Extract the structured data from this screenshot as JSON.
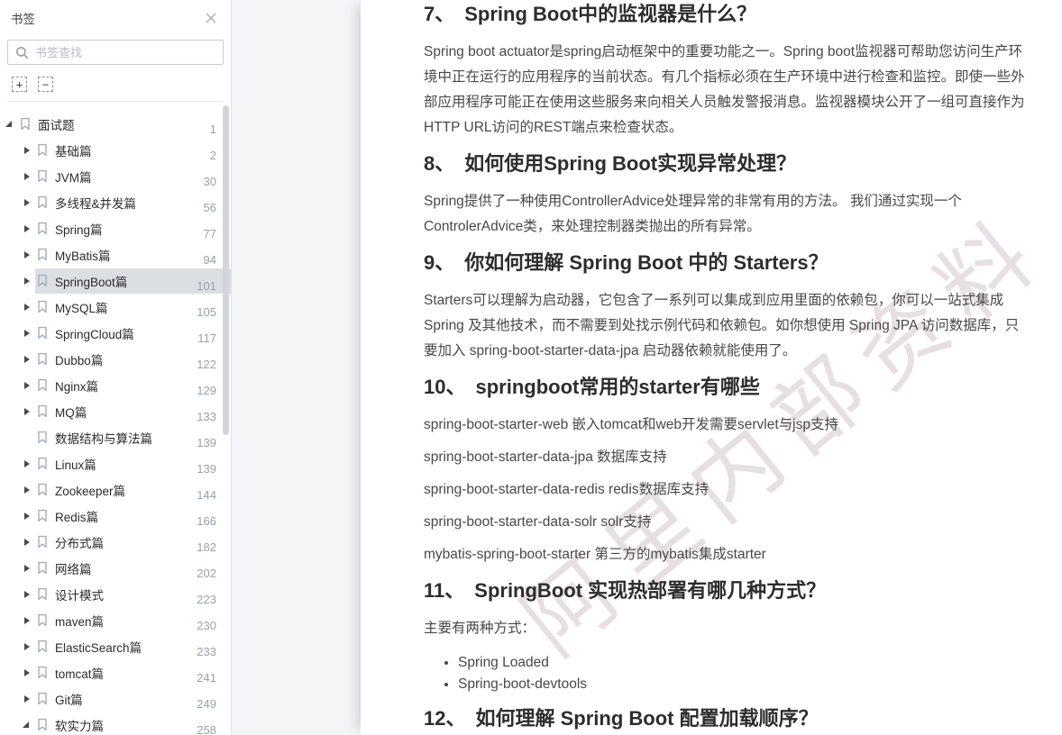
{
  "sidebar": {
    "title": "书签",
    "search": {
      "placeholder": "书签查找"
    },
    "toolbar": {
      "expand_all": "+",
      "collapse_all": "−"
    },
    "tree": [
      {
        "label": "面试题",
        "page": "1",
        "level": 0,
        "state": "expanded",
        "selected": false
      },
      {
        "label": "基础篇",
        "page": "2",
        "level": 1,
        "state": "collapsed",
        "selected": false
      },
      {
        "label": "JVM篇",
        "page": "30",
        "level": 1,
        "state": "collapsed",
        "selected": false
      },
      {
        "label": "多线程&并发篇",
        "page": "56",
        "level": 1,
        "state": "collapsed",
        "selected": false
      },
      {
        "label": "Spring篇",
        "page": "77",
        "level": 1,
        "state": "collapsed",
        "selected": false
      },
      {
        "label": "MyBatis篇",
        "page": "94",
        "level": 1,
        "state": "collapsed",
        "selected": false
      },
      {
        "label": "SpringBoot篇",
        "page": "101",
        "level": 1,
        "state": "collapsed",
        "selected": true
      },
      {
        "label": "MySQL篇",
        "page": "105",
        "level": 1,
        "state": "collapsed",
        "selected": false
      },
      {
        "label": "SpringCloud篇",
        "page": "117",
        "level": 1,
        "state": "collapsed",
        "selected": false
      },
      {
        "label": "Dubbo篇",
        "page": "122",
        "level": 1,
        "state": "collapsed",
        "selected": false
      },
      {
        "label": "Nginx篇",
        "page": "129",
        "level": 1,
        "state": "collapsed",
        "selected": false
      },
      {
        "label": "MQ篇",
        "page": "133",
        "level": 1,
        "state": "collapsed",
        "selected": false
      },
      {
        "label": "数据结构与算法篇",
        "page": "139",
        "level": 1,
        "state": "none",
        "selected": false
      },
      {
        "label": "Linux篇",
        "page": "139",
        "level": 1,
        "state": "collapsed",
        "selected": false
      },
      {
        "label": "Zookeeper篇",
        "page": "144",
        "level": 1,
        "state": "collapsed",
        "selected": false
      },
      {
        "label": "Redis篇",
        "page": "166",
        "level": 1,
        "state": "collapsed",
        "selected": false
      },
      {
        "label": "分布式篇",
        "page": "182",
        "level": 1,
        "state": "collapsed",
        "selected": false
      },
      {
        "label": "网络篇",
        "page": "202",
        "level": 1,
        "state": "collapsed",
        "selected": false
      },
      {
        "label": "设计模式",
        "page": "223",
        "level": 1,
        "state": "collapsed",
        "selected": false
      },
      {
        "label": "maven篇",
        "page": "230",
        "level": 1,
        "state": "collapsed",
        "selected": false
      },
      {
        "label": "ElasticSearch篇",
        "page": "233",
        "level": 1,
        "state": "collapsed",
        "selected": false
      },
      {
        "label": "tomcat篇",
        "page": "241",
        "level": 1,
        "state": "collapsed",
        "selected": false
      },
      {
        "label": "Git篇",
        "page": "249",
        "level": 1,
        "state": "collapsed",
        "selected": false
      },
      {
        "label": "软实力篇",
        "page": "258",
        "level": 1,
        "state": "expanded",
        "selected": false
      }
    ]
  },
  "document": {
    "watermark": "阿里内部资料",
    "sections": [
      {
        "type": "heading",
        "number": "7、",
        "title": "Spring Boot中的监视器是什么？"
      },
      {
        "type": "para",
        "text": "Spring boot actuator是spring启动框架中的重要功能之一。Spring boot监视器可帮助您访问生产环境中正在运行的应用程序的当前状态。有几个指标必须在生产环境中进行检查和监控。即使一些外部应用程序可能正在使用这些服务来向相关人员触发警报消息。监视器模块公开了一组可直接作为HTTP URL访问的REST端点来检查状态。"
      },
      {
        "type": "heading",
        "number": "8、",
        "title": "如何使用Spring Boot实现异常处理？"
      },
      {
        "type": "para",
        "text": "Spring提供了一种使用ControllerAdvice处理异常的非常有用的方法。 我们通过实现一个ControlerAdvice类，来处理控制器类抛出的所有异常。"
      },
      {
        "type": "heading",
        "number": "9、",
        "title": "你如何理解 Spring Boot 中的 Starters？"
      },
      {
        "type": "para",
        "text": "Starters可以理解为启动器，它包含了一系列可以集成到应用里面的依赖包，你可以一站式集成 Spring 及其他技术，而不需要到处找示例代码和依赖包。如你想使用 Spring JPA 访问数据库，只要加入 spring-boot-starter-data-jpa 启动器依赖就能使用了。"
      },
      {
        "type": "heading",
        "number": "10、",
        "title": "springboot常用的starter有哪些"
      },
      {
        "type": "para",
        "starter": true,
        "text": "spring-boot-starter-web 嵌入tomcat和web开发需要servlet与jsp支持"
      },
      {
        "type": "para",
        "starter": true,
        "text": "spring-boot-starter-data-jpa 数据库支持"
      },
      {
        "type": "para",
        "starter": true,
        "text": "spring-boot-starter-data-redis redis数据库支持"
      },
      {
        "type": "para",
        "starter": true,
        "text": "spring-boot-starter-data-solr solr支持"
      },
      {
        "type": "para",
        "starter": true,
        "text": "mybatis-spring-boot-starter 第三方的mybatis集成starter"
      },
      {
        "type": "heading",
        "number": "11、",
        "title": "SpringBoot 实现热部署有哪几种方式？"
      },
      {
        "type": "para",
        "text": "主要有两种方式："
      },
      {
        "type": "list",
        "items": [
          "Spring Loaded",
          "Spring-boot-devtools"
        ]
      },
      {
        "type": "heading",
        "number": "12、",
        "title": "如何理解 Spring Boot 配置加载顺序？"
      }
    ]
  },
  "colors": {
    "selected_row_bg": "#dbdfe4",
    "page_number_gray": "#9aa1ab",
    "gutter_bg": "#f4f5f7",
    "watermark": "#c4b6bf"
  }
}
